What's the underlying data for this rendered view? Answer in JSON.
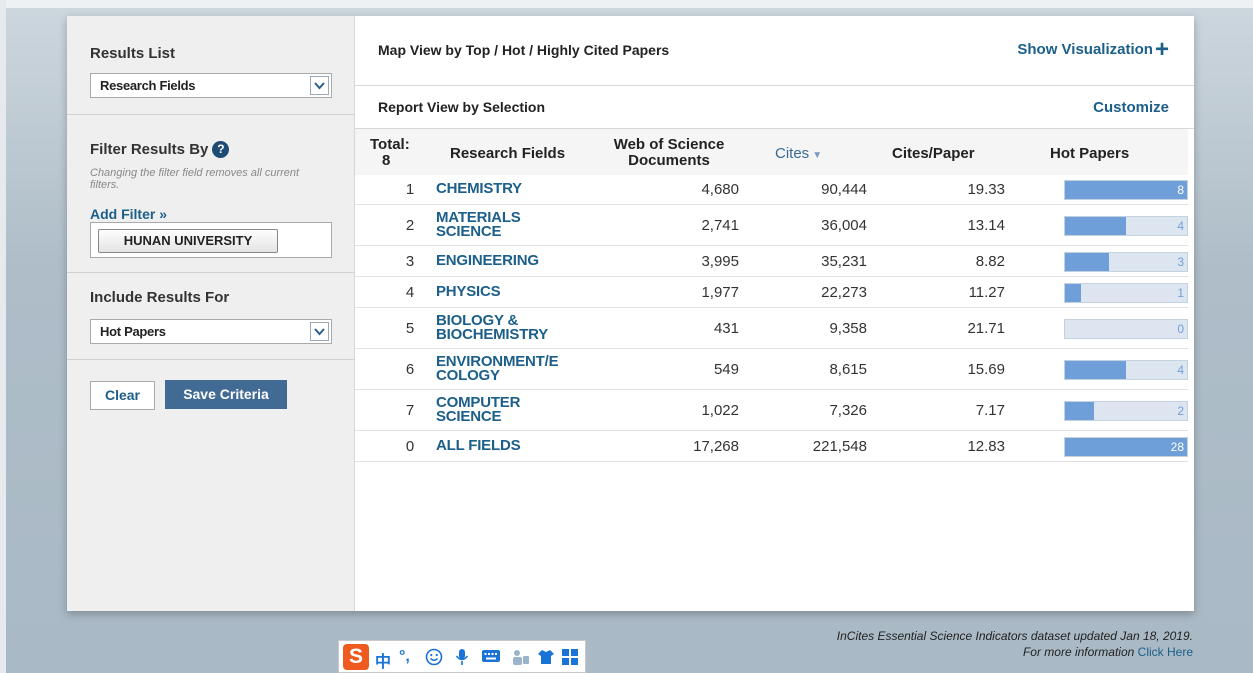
{
  "sidebar": {
    "results_list_title": "Results List",
    "results_list_value": "Research Fields",
    "filter_title": "Filter Results By",
    "filter_note": "Changing the filter field removes all current filters.",
    "add_filter": "Add Filter »",
    "filter_chip": "HUNAN UNIVERSITY",
    "include_title": "Include Results For",
    "include_value": "Hot Papers",
    "clear_label": "Clear",
    "save_label": "Save Criteria"
  },
  "main": {
    "map_title": "Map View by Top / Hot / Highly Cited Papers",
    "show_visualization": "Show Visualization",
    "report_title": "Report View by Selection",
    "customize": "Customize",
    "columns": {
      "total_label": "Total:",
      "total_value": "8",
      "field": "Research Fields",
      "docs_line1": "Web of Science",
      "docs_line2": "Documents",
      "cites": "Cites",
      "cites_per_paper": "Cites/Paper",
      "hot_papers": "Hot Papers"
    },
    "rows": [
      {
        "rank": "1",
        "field": [
          "CHEMISTRY"
        ],
        "docs": "4,680",
        "cites": "90,444",
        "cpp": "19.33",
        "hot": 8,
        "hot_fraction": 1.0
      },
      {
        "rank": "2",
        "field": [
          "MATERIALS",
          "SCIENCE"
        ],
        "docs": "2,741",
        "cites": "36,004",
        "cpp": "13.14",
        "hot": 4,
        "hot_fraction": 0.5
      },
      {
        "rank": "3",
        "field": [
          "ENGINEERING"
        ],
        "docs": "3,995",
        "cites": "35,231",
        "cpp": "8.82",
        "hot": 3,
        "hot_fraction": 0.36
      },
      {
        "rank": "4",
        "field": [
          "PHYSICS"
        ],
        "docs": "1,977",
        "cites": "22,273",
        "cpp": "11.27",
        "hot": 1,
        "hot_fraction": 0.13
      },
      {
        "rank": "5",
        "field": [
          "BIOLOGY &",
          "BIOCHEMISTRY"
        ],
        "docs": "431",
        "cites": "9,358",
        "cpp": "21.71",
        "hot": 0,
        "hot_fraction": 0.0
      },
      {
        "rank": "6",
        "field": [
          "ENVIRONMENT/E",
          "COLOGY"
        ],
        "docs": "549",
        "cites": "8,615",
        "cpp": "15.69",
        "hot": 4,
        "hot_fraction": 0.5
      },
      {
        "rank": "7",
        "field": [
          "COMPUTER",
          "SCIENCE"
        ],
        "docs": "1,022",
        "cites": "7,326",
        "cpp": "7.17",
        "hot": 2,
        "hot_fraction": 0.24
      },
      {
        "rank": "0",
        "field": [
          "ALL FIELDS"
        ],
        "docs": "17,268",
        "cites": "221,548",
        "cpp": "12.83",
        "hot": 28,
        "hot_fraction": 1.0
      }
    ]
  },
  "footer": {
    "line1": "InCites Essential Science Indicators dataset updated Jan 18, 2019.",
    "line2_prefix": "For more information",
    "line2_link": "Click Here"
  },
  "ime": {
    "logo": "S",
    "mode": "中",
    "punct": "°,",
    "icons": [
      "smiley-icon",
      "microphone-icon",
      "keyboard-icon",
      "tools-icon",
      "skin-icon",
      "grid-icon"
    ]
  },
  "colors": {
    "link": "#1b5f8a",
    "save_button": "#416a94",
    "bar_fill": "#6f9fd8",
    "bar_track": "#dde6f0"
  }
}
